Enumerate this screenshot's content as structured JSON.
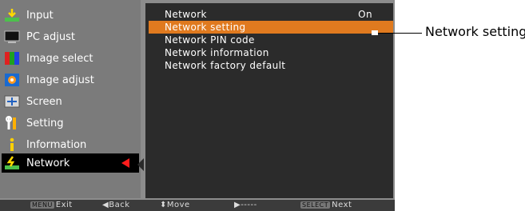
{
  "menu": {
    "items": [
      {
        "label": "Input",
        "icon": "input-icon"
      },
      {
        "label": "PC adjust",
        "icon": "pc-adjust-icon"
      },
      {
        "label": "Image select",
        "icon": "image-select-icon"
      },
      {
        "label": "Image adjust",
        "icon": "image-adjust-icon"
      },
      {
        "label": "Screen",
        "icon": "screen-icon"
      },
      {
        "label": "Setting",
        "icon": "setting-icon"
      },
      {
        "label": "Information",
        "icon": "information-icon"
      },
      {
        "label": "Network",
        "icon": "network-icon",
        "selected": true
      }
    ]
  },
  "submenu": {
    "items": [
      {
        "label": "Network",
        "value": "On"
      },
      {
        "label": "Network setting",
        "highlighted": true
      },
      {
        "label": "Network PIN code"
      },
      {
        "label": "Network information"
      },
      {
        "label": "Network factory default"
      }
    ]
  },
  "statusbar": {
    "exit_badge": "MENU",
    "exit": "Exit",
    "back": "Back",
    "move": "Move",
    "next_placeholder": "-----",
    "next_badge": "SELECT",
    "next": "Next"
  },
  "callout": {
    "label": "Network setting"
  },
  "colors": {
    "highlight": "#e07a1f",
    "pointer": "#ff1c1c",
    "panel": "#2b2b2b"
  }
}
